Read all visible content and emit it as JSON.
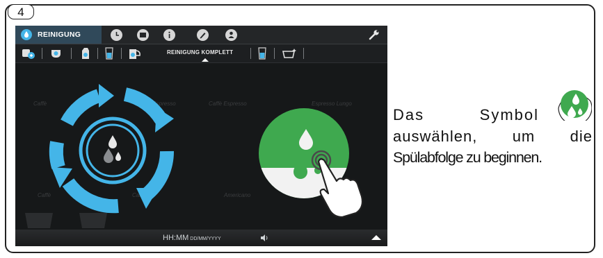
{
  "step": {
    "number": "4"
  },
  "machine_ui": {
    "header": {
      "active_tab_label": "REINIGUNG",
      "icons": [
        "water-drop-icon",
        "clock-icon",
        "folder-icon",
        "info-icon",
        "pencil-icon",
        "user-icon",
        "wrench-icon"
      ]
    },
    "subnav": {
      "items": [
        "cup-descale-icon",
        "cup-icon",
        "milk-carton-icon",
        "glass-icon",
        "milk-jug-icon",
        "glass-icon",
        "tray-cleaning-icon"
      ],
      "active_label": "REINIGUNG KOMPLETT"
    },
    "background_labels": [
      "Caffè",
      "Caffè Espresso",
      "Caffè Espresso",
      "Espresso Lungo",
      "Caffè",
      "Caffè",
      "Americano"
    ],
    "footer": {
      "time": "HH:MM",
      "date": "DD/MM/YYYY"
    }
  },
  "instruction": {
    "line1_words": [
      "Das",
      "Symbol"
    ],
    "line2_words": [
      "auswählen,",
      "um",
      "die"
    ],
    "line3": "Spülabfolge zu beginnen."
  },
  "colors": {
    "accent_blue": "#44b5e8",
    "rinse_green": "#3fa94f",
    "frame": "#222222"
  }
}
